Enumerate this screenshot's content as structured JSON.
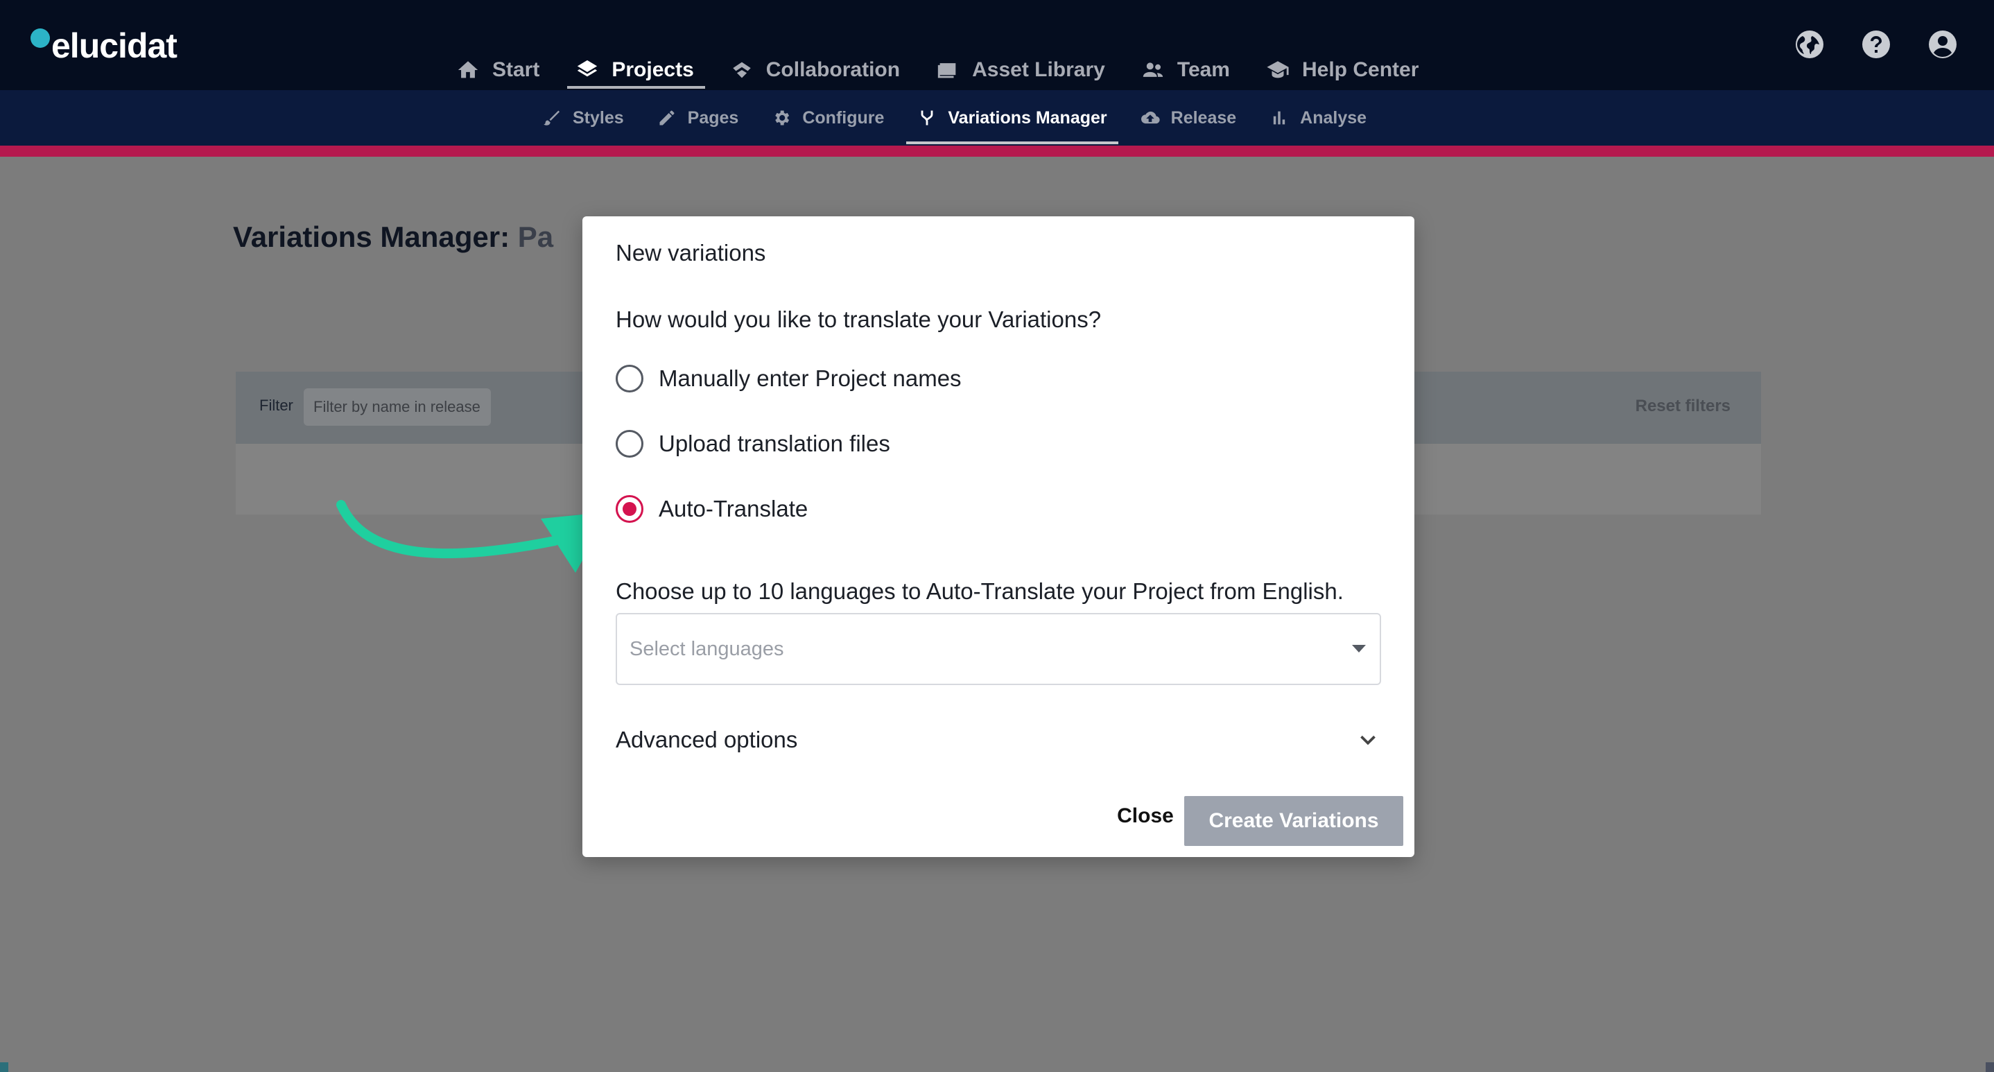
{
  "app": {
    "logo_text": "elucidat"
  },
  "main_nav": [
    {
      "label": "Start",
      "icon": "home-icon",
      "active": false
    },
    {
      "label": "Projects",
      "icon": "layers-icon",
      "active": true
    },
    {
      "label": "Collaboration",
      "icon": "handshake-icon",
      "active": false
    },
    {
      "label": "Asset Library",
      "icon": "images-icon",
      "active": false
    },
    {
      "label": "Team",
      "icon": "people-icon",
      "active": false
    },
    {
      "label": "Help Center",
      "icon": "graduation-cap-icon",
      "active": false
    }
  ],
  "utility_icons": [
    "globe-icon",
    "help-icon",
    "account-icon"
  ],
  "sub_nav": [
    {
      "label": "Styles",
      "icon": "brush-icon",
      "active": false
    },
    {
      "label": "Pages",
      "icon": "pencil-icon",
      "active": false
    },
    {
      "label": "Configure",
      "icon": "gear-icon",
      "active": false
    },
    {
      "label": "Variations Manager",
      "icon": "fork-icon",
      "active": true
    },
    {
      "label": "Release",
      "icon": "cloud-upload-icon",
      "active": false
    },
    {
      "label": "Analyse",
      "icon": "bar-chart-icon",
      "active": false
    }
  ],
  "page": {
    "title_prefix": "Variations Manager:",
    "title_suffix": "Pa",
    "filter_label": "Filter",
    "filter_placeholder": "Filter by name in release",
    "reset_filters": "Reset filters"
  },
  "modal": {
    "title": "New variations",
    "question": "How would you like to translate your Variations?",
    "options": [
      {
        "label": "Manually enter Project names",
        "checked": false
      },
      {
        "label": "Upload translation files",
        "checked": false
      },
      {
        "label": "Auto-Translate",
        "checked": true
      }
    ],
    "choose_label": "Choose up to 10 languages to Auto-Translate your Project from English.",
    "select_placeholder": "Select languages",
    "advanced_label": "Advanced options",
    "close_label": "Close",
    "create_label": "Create Variations"
  },
  "colors": {
    "accent": "#d4134f",
    "annotation_arrow": "#1fcf9f",
    "header_bg": "#050d1f",
    "subnav_bg": "#0b1a3d"
  }
}
